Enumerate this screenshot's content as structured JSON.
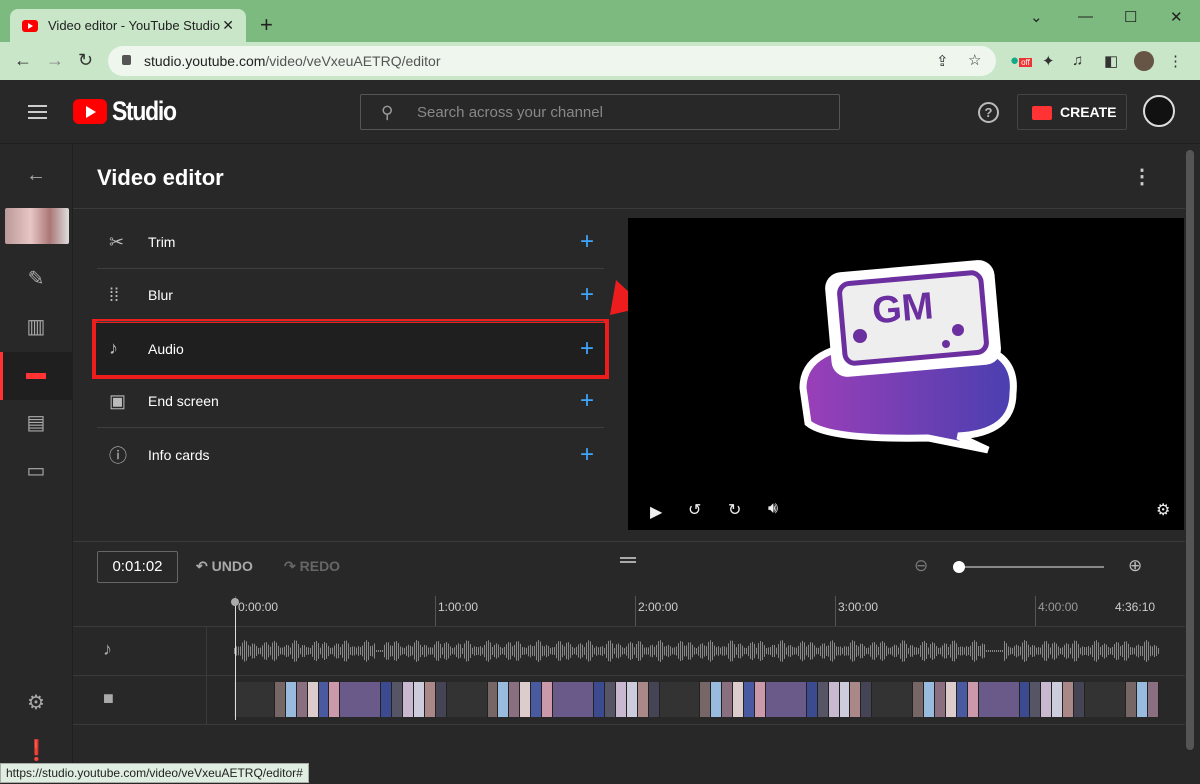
{
  "browser": {
    "tab_title": "Video editor - YouTube Studio",
    "url_host": "studio.youtube.com",
    "url_path": "/video/veVxeuAETRQ/editor",
    "extension_badge": "off",
    "status_url": "https://studio.youtube.com/video/veVxeuAETRQ/editor#"
  },
  "header": {
    "logo_text": "Studio",
    "search_placeholder": "Search across your channel",
    "create_label": "CREATE"
  },
  "page": {
    "title": "Video editor"
  },
  "tools": [
    {
      "label": "Trim",
      "icon": "scissors-icon"
    },
    {
      "label": "Blur",
      "icon": "blur-icon"
    },
    {
      "label": "Audio",
      "icon": "music-note-icon",
      "highlighted": true
    },
    {
      "label": "End screen",
      "icon": "end-screen-icon"
    },
    {
      "label": "Info cards",
      "icon": "info-icon"
    }
  ],
  "preview": {
    "logo_text": "GM"
  },
  "timeline": {
    "current_time": "0:01:02",
    "undo_label": "UNDO",
    "redo_label": "REDO",
    "ruler": [
      "0:00:00",
      "1:00:00",
      "2:00:00",
      "3:00:00",
      "4:00:00",
      "4:36:10"
    ],
    "zoom_level": 0
  },
  "colors": {
    "accent": "#3ea6ff",
    "highlight": "#ee1d1d",
    "brand": "#ff0000"
  }
}
